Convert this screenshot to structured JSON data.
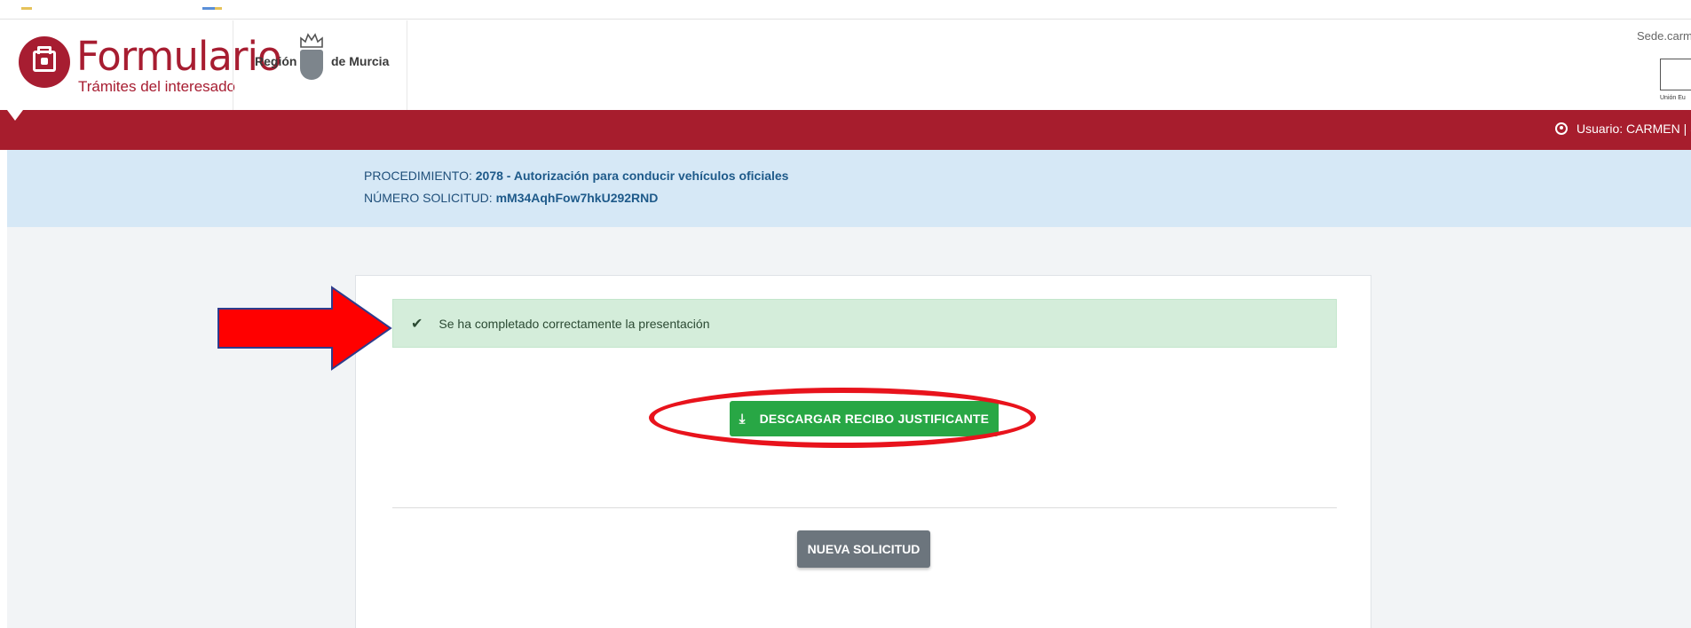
{
  "header": {
    "brand_title": "Formulario",
    "brand_subtitle": "Trámites del interesado",
    "region_left": "Región",
    "region_right": "de Murcia",
    "sede": "Sede.carm",
    "eu_label": "Unión Eu"
  },
  "navbar": {
    "user": "Usuario: CARMEN | S"
  },
  "info": {
    "procedure_label": "PROCEDIMIENTO: ",
    "procedure_value": "2078 - Autorización para conducir vehículos oficiales",
    "request_label": "NÚMERO SOLICITUD: ",
    "request_value": "mM34AqhFow7hkU292RND"
  },
  "main": {
    "alert_message": "Se ha completado correctamente la presentación",
    "download_button": "DESCARGAR RECIBO JUSTIFICANTE",
    "new_request_button": "NUEVA SOLICITUD"
  },
  "colors": {
    "brand": "#a71d31",
    "navbar": "#a71d2d",
    "info_band": "#d6e8f6",
    "success": "#28a745",
    "secondary": "#6c757d",
    "annotation": "#e8131c"
  },
  "icons": {
    "logo": "form-document-icon",
    "check": "check-icon",
    "download": "download-icon",
    "user": "user-circle-icon"
  }
}
